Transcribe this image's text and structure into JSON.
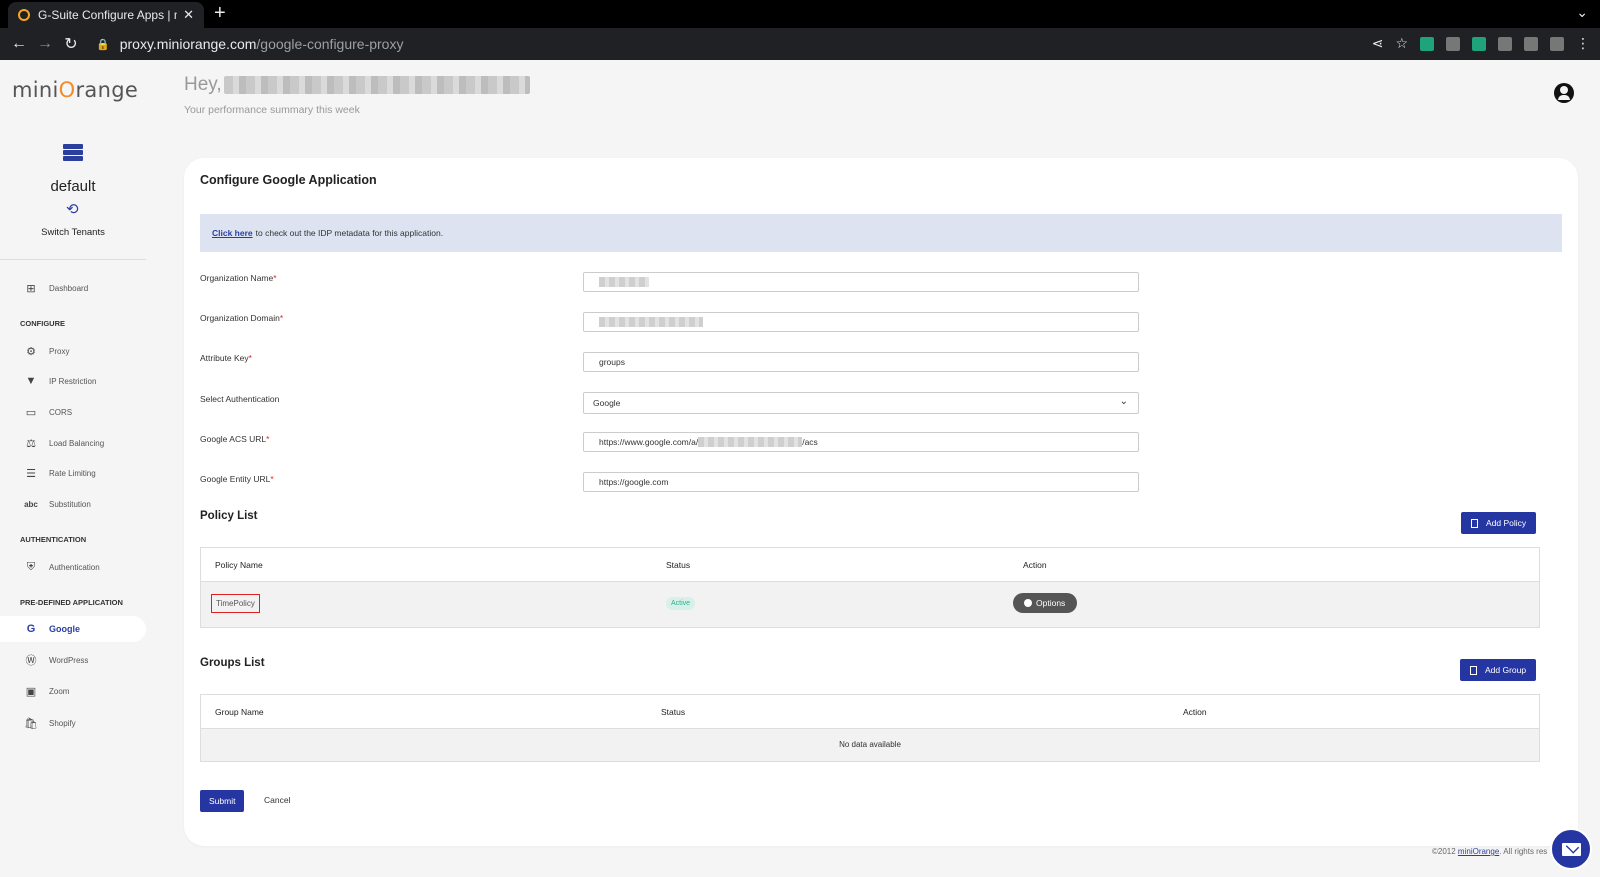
{
  "browser": {
    "tab_title": "G-Suite Configure Apps | min",
    "url_host": "proxy.miniorange.com",
    "url_path": "/google-configure-proxy"
  },
  "brand": {
    "logo_pre": "mini",
    "logo_o": "O",
    "logo_post": "range"
  },
  "tenant": {
    "name": "default",
    "switch_label": "Switch Tenants"
  },
  "sidebar": {
    "dashboard": "Dashboard",
    "configure_section": "CONFIGURE",
    "configure_items": [
      "Proxy",
      "IP Restriction",
      "CORS",
      "Load Balancing",
      "Rate Limiting",
      "Substitution"
    ],
    "authentication_section": "AUTHENTICATION",
    "authentication_item": "Authentication",
    "predefined_section": "PRE-DEFINED APPLICATION",
    "predefined_items": [
      "Google",
      "WordPress",
      "Zoom",
      "Shopify"
    ],
    "active_item": "Google"
  },
  "header": {
    "greeting": "Hey,",
    "subtitle": "Your performance summary this week"
  },
  "form": {
    "title": "Configure Google Application",
    "banner_link": "Click here",
    "banner_text": "to check out the IDP metadata for this application.",
    "org_name_label": "Organization Name",
    "org_domain_label": "Organization Domain",
    "attribute_key_label": "Attribute Key",
    "attribute_key_value": "groups",
    "select_auth_label": "Select Authentication",
    "select_auth_value": "Google",
    "acs_url_label": "Google ACS URL",
    "acs_url_prefix": "https://www.google.com/a/",
    "acs_url_suffix": "/acs",
    "entity_url_label": "Google Entity URL",
    "entity_url_value": "https://google.com",
    "required_mark": "*"
  },
  "policy_list": {
    "title": "Policy List",
    "add_button": "Add Policy",
    "headers": [
      "Policy Name",
      "Status",
      "Action"
    ],
    "rows": [
      {
        "name": "TimePolicy",
        "status": "Active",
        "action": "Options"
      }
    ]
  },
  "groups_list": {
    "title": "Groups List",
    "add_button": "Add Group",
    "headers": [
      "Group Name",
      "Status",
      "Action"
    ],
    "empty_text": "No data available"
  },
  "actions": {
    "submit": "Submit",
    "cancel": "Cancel"
  },
  "footer": {
    "prefix": "©2012 ",
    "link": "miniOrange",
    "suffix": ". All rights res"
  },
  "colors": {
    "primary": "#2536a3",
    "active_badge_bg": "#d7f1ea",
    "active_badge_text": "#2fae8f",
    "highlight_border": "#dd2222"
  }
}
